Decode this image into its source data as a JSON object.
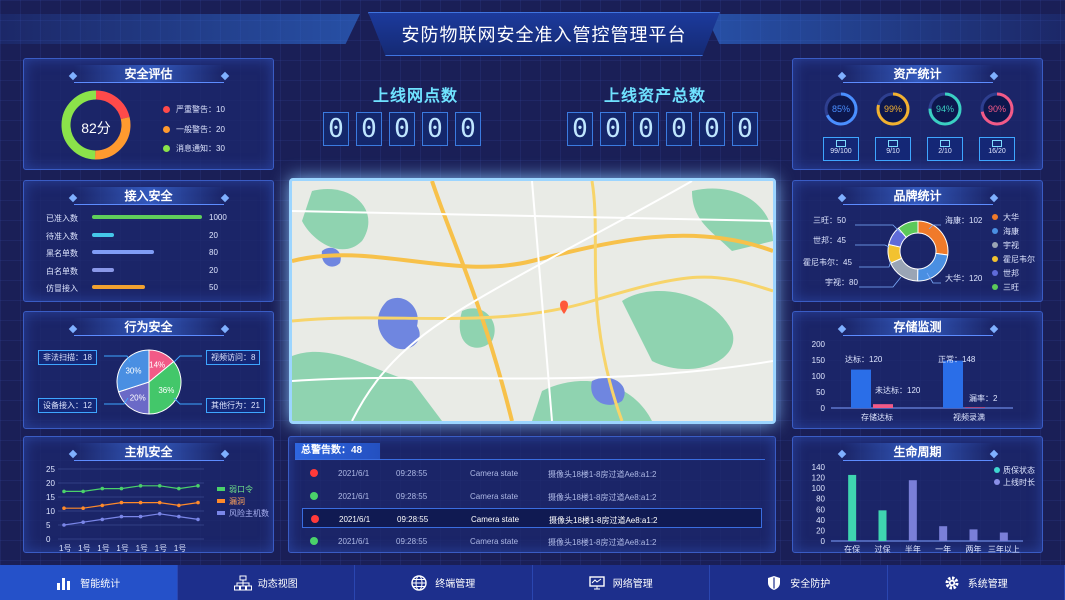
{
  "header": {
    "title": "安防物联网安全准入管控管理平台"
  },
  "security_eval": {
    "title": "安全评估",
    "score": "82分",
    "legend": [
      {
        "label": "严重警告：10",
        "color": "#ff4a4a"
      },
      {
        "label": "一般警告：20",
        "color": "#ff9a2f"
      },
      {
        "label": "消息通知：30",
        "color": "#8be34a"
      }
    ]
  },
  "access": {
    "title": "接入安全",
    "rows": [
      {
        "label": "已准入数",
        "value": "1000",
        "ratio": 1.0,
        "color": "#5fcf5a"
      },
      {
        "label": "待准入数",
        "value": "20",
        "ratio": 0.2,
        "color": "#45c7e8"
      },
      {
        "label": "黑名单数",
        "value": "80",
        "ratio": 0.56,
        "color": "#7f9cf5"
      },
      {
        "label": "白名单数",
        "value": "20",
        "ratio": 0.2,
        "color": "#8a98e8"
      },
      {
        "label": "仿冒接入",
        "value": "50",
        "ratio": 0.48,
        "color": "#f2a230"
      }
    ]
  },
  "behavior": {
    "title": "行为安全",
    "tags": [
      "非法扫描：18",
      "视频访问：8",
      "设备接入：12",
      "其他行为：21"
    ],
    "pie": [
      {
        "label": "14%",
        "value": 14,
        "color": "#f25a87"
      },
      {
        "label": "36%",
        "value": 36,
        "color": "#43c76a"
      },
      {
        "label": "20%",
        "value": 20,
        "color": "#6b6ac7"
      },
      {
        "label": "30%",
        "value": 30,
        "color": "#4a8fe2"
      }
    ]
  },
  "host": {
    "title": "主机安全",
    "chart_data": {
      "type": "line",
      "x": [
        "1号",
        "1号",
        "1号",
        "1号",
        "1号",
        "1号",
        "1号",
        "1号"
      ],
      "ylim": [
        0,
        25
      ],
      "yticks": [
        "0",
        "5",
        "10",
        "15",
        "20",
        "25"
      ],
      "series": [
        {
          "name": "弱口令",
          "color": "#4ad16a",
          "values": [
            17,
            17,
            18,
            18,
            19,
            19,
            18,
            19
          ]
        },
        {
          "name": "漏洞",
          "color": "#ff8a2a",
          "values": [
            11,
            11,
            12,
            13,
            13,
            13,
            12,
            13
          ]
        },
        {
          "name": "风险主机数",
          "color": "#7a86e8",
          "values": [
            5,
            6,
            7,
            8,
            8,
            9,
            8,
            7
          ]
        }
      ]
    }
  },
  "counters": [
    {
      "title": "上线网点数",
      "digits": [
        "0",
        "0",
        "0",
        "0",
        "0"
      ]
    },
    {
      "title": "上线资产总数",
      "digits": [
        "0",
        "0",
        "0",
        "0",
        "0",
        "0"
      ]
    }
  ],
  "alarm": {
    "title": "总警告数：48",
    "rows": [
      {
        "date": "2021/6/1",
        "time": "09:28:55",
        "type": "Camera state",
        "msg": "摄像头18楼1-8房过道Ae8:a1:2",
        "color": "#ff3a3a",
        "highlight": false
      },
      {
        "date": "2021/6/1",
        "time": "09:28:55",
        "type": "Camera state",
        "msg": "摄像头18楼1-8房过道Ae8:a1:2",
        "color": "#4ad16a",
        "highlight": false
      },
      {
        "date": "2021/6/1",
        "time": "09:28:55",
        "type": "Camera state",
        "msg": "摄像头18楼1-8房过道Ae8:a1:2",
        "color": "#ff3a3a",
        "highlight": true
      },
      {
        "date": "2021/6/1",
        "time": "09:28:55",
        "type": "Camera state",
        "msg": "摄像头18楼1-8房过道Ae8:a1:2",
        "color": "#4ad16a",
        "highlight": false
      }
    ]
  },
  "asset": {
    "title": "资产统计",
    "rings": [
      {
        "pct": "85%",
        "value": 0.85,
        "color": "#4a8fff",
        "count": "99/100"
      },
      {
        "pct": "99%",
        "value": 0.99,
        "color": "#f2b12f",
        "count": "9/10"
      },
      {
        "pct": "94%",
        "value": 0.94,
        "color": "#3ad0c2",
        "count": "2/10"
      },
      {
        "pct": "90%",
        "value": 0.9,
        "color": "#f25a87",
        "count": "16/20"
      }
    ]
  },
  "brand": {
    "title": "品牌统计",
    "labels": [
      "三旺：50",
      "世邦：45",
      "霍尼韦尔：45",
      "宇视：80",
      "海康：102",
      "大华：120"
    ],
    "chart_data": {
      "type": "pie",
      "categories": [
        "大华",
        "海康",
        "宇视",
        "霍尼韦尔",
        "世邦",
        "三旺"
      ],
      "values": [
        120,
        102,
        80,
        45,
        45,
        50
      ],
      "colors": [
        "#f07a2a",
        "#4a8fe2",
        "#9aa5b5",
        "#f2c230",
        "#5f6bd8",
        "#5cc95a"
      ]
    },
    "legend": [
      "大华",
      "海康",
      "宇视",
      "霍尼韦尔",
      "世邦",
      "三旺"
    ]
  },
  "storage": {
    "title": "存储监测",
    "chart_data": {
      "type": "bar",
      "categories": [
        "存储达标",
        "视频录满"
      ],
      "ylim": [
        0,
        200
      ],
      "yticks": [
        "0",
        "50",
        "100",
        "150",
        "200"
      ],
      "series": [
        {
          "color": "#2a6ee8",
          "values": [
            120,
            148
          ]
        },
        {
          "color": "#f25a87",
          "values": [
            12,
            2
          ]
        }
      ],
      "annotations": [
        "达标：120",
        "未达标：120",
        "正常：148",
        "漏率：2"
      ]
    }
  },
  "lifecycle": {
    "title": "生命周期",
    "chart_data": {
      "type": "bar",
      "categories": [
        "在保",
        "过保",
        "半年",
        "一年",
        "两年",
        "三年以上"
      ],
      "ylim": [
        0,
        140
      ],
      "yticks": [
        "0",
        "20",
        "40",
        "60",
        "80",
        "100",
        "120",
        "140"
      ],
      "values": [
        125,
        58,
        115,
        28,
        22,
        16
      ],
      "colors": [
        "#3fd5b0",
        "#3fd5b0",
        "#7a7fd8",
        "#7a7fd8",
        "#7a7fd8",
        "#7a7fd8"
      ],
      "legend": [
        {
          "name": "质保状态",
          "color": "#3fd5d0"
        },
        {
          "name": "上线时长",
          "color": "#8a8fe8"
        }
      ]
    }
  },
  "nav": [
    {
      "label": "智能统计",
      "icon": "bar-chart-icon",
      "active": true
    },
    {
      "label": "动态视图",
      "icon": "org-chart-icon",
      "active": false
    },
    {
      "label": "终端管理",
      "icon": "globe-icon",
      "active": false
    },
    {
      "label": "网络管理",
      "icon": "monitor-icon",
      "active": false
    },
    {
      "label": "安全防护",
      "icon": "shield-icon",
      "active": false
    },
    {
      "label": "系统管理",
      "icon": "gear-icon",
      "active": false
    }
  ]
}
